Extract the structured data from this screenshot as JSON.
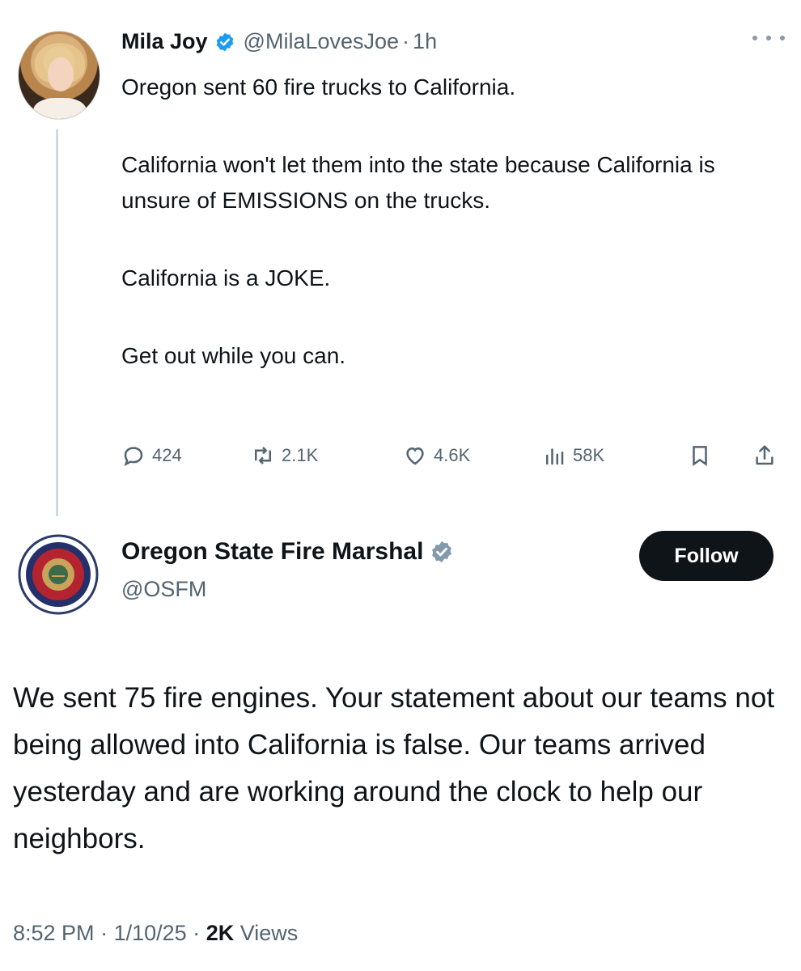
{
  "parent_tweet": {
    "author_name": "Mila Joy",
    "handle": "@MilaLovesJoe",
    "separator": "·",
    "time_ago": "1h",
    "paragraphs": [
      "Oregon sent 60 fire trucks to California.",
      "California won't let them into the state because California is unsure of EMISSIONS on the trucks.",
      "California is a JOKE.",
      "Get out while you can."
    ],
    "stats": {
      "replies": "424",
      "reposts": "2.1K",
      "likes": "4.6K",
      "views": "58K"
    },
    "icons": [
      "verified-badge",
      "more-icon",
      "reply-icon",
      "repost-icon",
      "like-icon",
      "views-icon",
      "bookmark-icon",
      "share-icon"
    ]
  },
  "reply_tweet": {
    "author_name": "Oregon State Fire Marshal",
    "handle": "@OSFM",
    "follow_label": "Follow",
    "text": "We sent 75 fire engines. Your statement about our teams not being allowed into California is false. Our teams arrived yesterday and are working around the clock to help our neighbors.",
    "time": "8:52 PM",
    "date": "1/10/25",
    "view_count": "2K",
    "views_label": "Views"
  },
  "colors": {
    "verified_blue": "#1d9bf0",
    "verified_gray": "#829aab",
    "text_primary": "#0f1419",
    "text_secondary": "#536471",
    "thread_line": "#cfd9de"
  }
}
